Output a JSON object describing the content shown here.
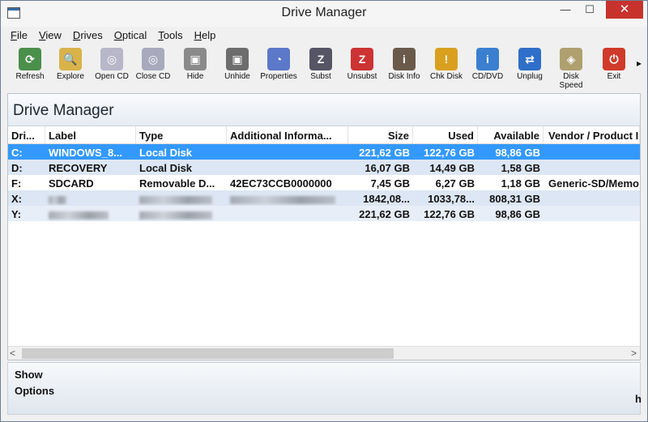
{
  "window": {
    "title": "Drive Manager"
  },
  "menu": [
    {
      "prefix": "",
      "accel": "F",
      "rest": "ile"
    },
    {
      "prefix": "",
      "accel": "V",
      "rest": "iew"
    },
    {
      "prefix": "",
      "accel": "D",
      "rest": "rives"
    },
    {
      "prefix": "",
      "accel": "O",
      "rest": "ptical"
    },
    {
      "prefix": "",
      "accel": "T",
      "rest": "ools"
    },
    {
      "prefix": "",
      "accel": "H",
      "rest": "elp"
    }
  ],
  "toolbar": [
    {
      "label": "Refresh",
      "icon": "refresh-icon",
      "glyph": "⟳",
      "color": "#4a8f4a"
    },
    {
      "label": "Explore",
      "icon": "explore-icon",
      "glyph": "🔍",
      "color": "#d9b34a"
    },
    {
      "label": "Open CD",
      "icon": "open-cd-icon",
      "glyph": "◎",
      "color": "#b7b7c9"
    },
    {
      "label": "Close CD",
      "icon": "close-cd-icon",
      "glyph": "◎",
      "color": "#a9a9bd"
    },
    {
      "label": "Hide",
      "icon": "hide-icon",
      "glyph": "▣",
      "color": "#8a8a8a"
    },
    {
      "label": "Unhide",
      "icon": "unhide-icon",
      "glyph": "▣",
      "color": "#6d6d6d"
    },
    {
      "label": "Properties",
      "icon": "properties-icon",
      "glyph": "◔",
      "color": "#5b78c9"
    },
    {
      "label": "Subst",
      "icon": "subst-icon",
      "glyph": "Z",
      "color": "#556"
    },
    {
      "label": "Unsubst",
      "icon": "unsubst-icon",
      "glyph": "Z",
      "color": "#c33"
    },
    {
      "label": "Disk Info",
      "icon": "disk-info-icon",
      "glyph": "i",
      "color": "#6b5a4a"
    },
    {
      "label": "Chk Disk",
      "icon": "check-disk-icon",
      "glyph": "!",
      "color": "#d9a020"
    },
    {
      "label": "CD/DVD",
      "icon": "cd-dvd-info-icon",
      "glyph": "i",
      "color": "#3a7fd0"
    },
    {
      "label": "Unplug",
      "icon": "unplug-icon",
      "glyph": "⇄",
      "color": "#2f6fc9"
    },
    {
      "label": "Disk Speed",
      "icon": "disk-speed-icon",
      "glyph": "◈",
      "color": "#b0a070"
    },
    {
      "label": "Exit",
      "icon": "exit-icon",
      "glyph": "⏻",
      "color": "#d03a2a"
    }
  ],
  "panel": {
    "title": "Drive Manager"
  },
  "columns": [
    "Dri...",
    "Label",
    "Type",
    "Additional Informa...",
    "Size",
    "Used",
    "Available",
    "Vendor / Product I"
  ],
  "drives": [
    {
      "drive": "C:",
      "label": "WINDOWS_8...",
      "type": "Local Disk",
      "info": "",
      "size": "221,62 GB",
      "used": "122,76 GB",
      "available": "98,86 GB",
      "vendor": ""
    },
    {
      "drive": "D:",
      "label": "RECOVERY",
      "type": "Local Disk",
      "info": "",
      "size": "16,07 GB",
      "used": "14,49 GB",
      "available": "1,58 GB",
      "vendor": ""
    },
    {
      "drive": "F:",
      "label": "SDCARD",
      "type": "Removable D...",
      "info": "42EC73CCB0000000",
      "size": "7,45 GB",
      "used": "6,27 GB",
      "available": "1,18 GB",
      "vendor": "Generic-SD/Memo"
    },
    {
      "drive": "X:",
      "label": "",
      "type": "",
      "info": "",
      "size": "1842,08...",
      "used": "1033,78...",
      "available": "808,31 GB",
      "vendor": ""
    },
    {
      "drive": "Y:",
      "label": "",
      "type": "",
      "info": "",
      "size": "221,62 GB",
      "used": "122,76 GB",
      "available": "98,86 GB",
      "vendor": ""
    }
  ],
  "footer": {
    "show": "Show",
    "options": "Options",
    "trailing": "h"
  }
}
